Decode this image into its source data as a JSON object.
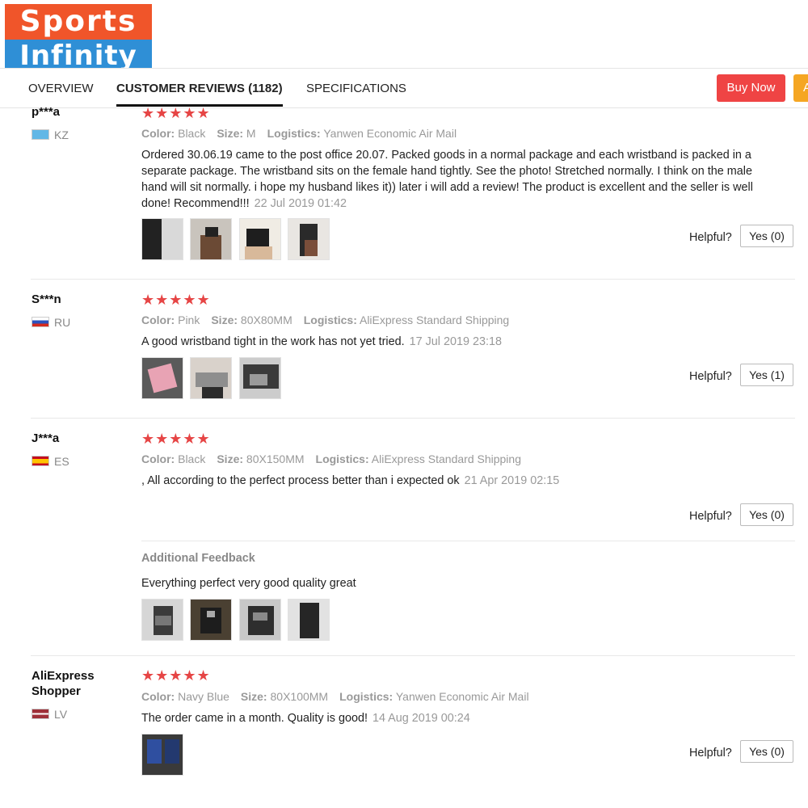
{
  "logo": {
    "top": "Sports",
    "bottom": "Infinity"
  },
  "tabs": {
    "overview": "OVERVIEW",
    "reviews": "CUSTOMER REVIEWS (1182)",
    "specifications": "SPECIFICATIONS"
  },
  "actions": {
    "buy_now": "Buy Now",
    "add_to_cart_partial": "A"
  },
  "colors": {
    "star": "#e64545",
    "buy_now": "#ef4444",
    "add_to_cart": "#f5a623",
    "logo_orange": "#f0552a",
    "logo_blue": "#2f8fd6"
  },
  "labels": {
    "color": "Color:",
    "size": "Size:",
    "logistics": "Logistics:",
    "helpful": "Helpful?",
    "additional_feedback": "Additional Feedback"
  },
  "reviews": [
    {
      "user": "p***a",
      "country": "KZ",
      "stars": "★★★★★",
      "color": "Black",
      "size": "M",
      "logistics": "Yanwen Economic Air Mail",
      "text": "Ordered 30.06.19 came to the post office 20.07. Packed goods in a normal package and each wristband is packed in a separate package. The wristband sits on the female hand tightly. See the photo! Stretched normally. I think on the male hand will sit normally. i hope my husband likes it)) later i will add a review! The product is excellent and the seller is well done! Recommend!!!",
      "date": "22 Jul 2019 01:42",
      "helpful": "Yes (0)"
    },
    {
      "user": "S***n",
      "country": "RU",
      "stars": "★★★★★",
      "color": "Pink",
      "size": "80X80MM",
      "logistics": "AliExpress Standard Shipping",
      "text": "A good wristband tight in the work has not yet tried.",
      "date": "17 Jul 2019 23:18",
      "helpful": "Yes (1)"
    },
    {
      "user": "J***a",
      "country": "ES",
      "stars": "★★★★★",
      "color": "Black",
      "size": "80X150MM",
      "logistics": "AliExpress Standard Shipping",
      "text": ", All according to the perfect process better than i expected ok",
      "date": "21 Apr 2019 02:15",
      "helpful": "Yes (0)",
      "additional_feedback": "Everything perfect very good quality great"
    },
    {
      "user": "AliExpress Shopper",
      "country": "LV",
      "stars": "★★★★★",
      "color": "Navy Blue",
      "size": "80X100MM",
      "logistics": "Yanwen Economic Air Mail",
      "text": "The order came in a month. Quality is good!",
      "date": "14 Aug 2019 00:24",
      "helpful": "Yes (0)"
    }
  ]
}
